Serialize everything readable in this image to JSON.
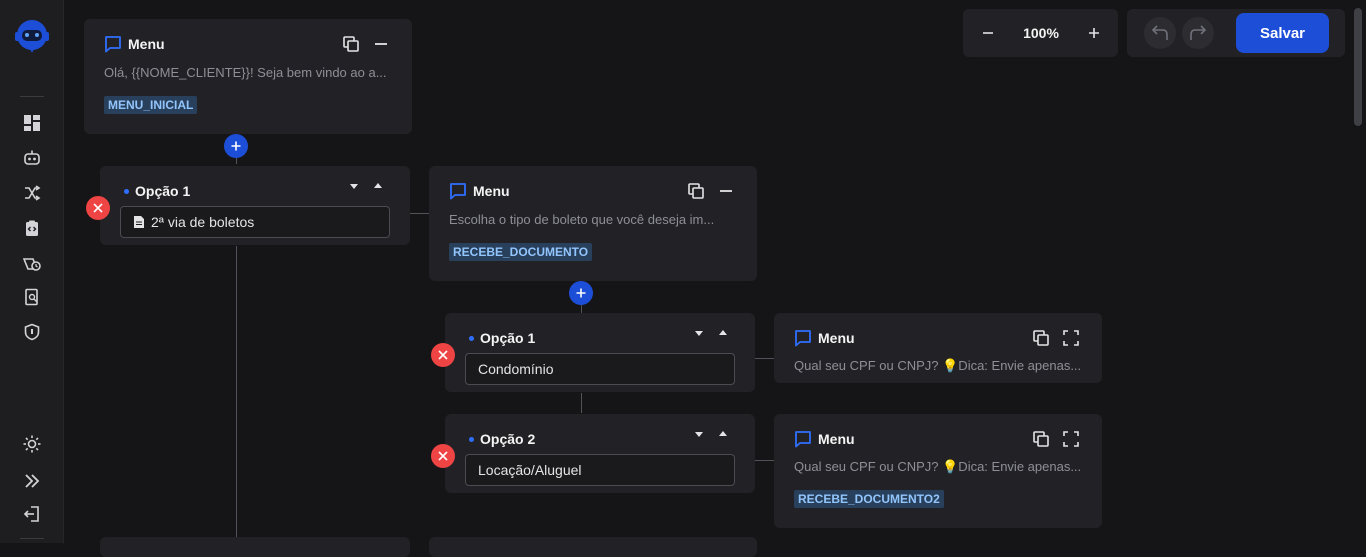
{
  "colors": {
    "accent": "#1d4ed8",
    "danger": "#ef4444",
    "tag_text": "#93c5fd",
    "tag_bg": "#28405c"
  },
  "sidebar": {
    "logo_icon": "robot-logo-icon",
    "items": [
      {
        "icon": "dashboard-icon"
      },
      {
        "icon": "robot-icon"
      },
      {
        "icon": "shuffle-icon"
      },
      {
        "icon": "code-clipboard-icon"
      },
      {
        "icon": "broadcast-clock-icon"
      },
      {
        "icon": "document-search-icon"
      },
      {
        "icon": "shield-icon"
      }
    ],
    "bottom_items": [
      {
        "icon": "sun-icon"
      },
      {
        "icon": "double-chevron-right-icon"
      },
      {
        "icon": "logout-icon"
      }
    ]
  },
  "toolbar": {
    "zoom": "100%",
    "save_label": "Salvar"
  },
  "flow": {
    "menu_root": {
      "title": "Menu",
      "text": "Olá, {{NOME_CLIENTE}}! Seja bem vindo ao a...",
      "tag": "MENU_INICIAL"
    },
    "option_a1": {
      "label": "Opção 1",
      "value": "2ª via de boletos"
    },
    "menu_boleto": {
      "title": "Menu",
      "text": "Escolha o tipo de boleto que você deseja im...",
      "tag": "RECEBE_DOCUMENTO"
    },
    "option_b1": {
      "label": "Opção 1",
      "value": "Condomínio"
    },
    "menu_cond": {
      "title": "Menu",
      "text": "Qual seu CPF ou CNPJ? 💡Dica: Envie apenas..."
    },
    "option_b2": {
      "label": "Opção 2",
      "value": "Locação/Aluguel"
    },
    "menu_loc": {
      "title": "Menu",
      "text": "Qual seu CPF ou CNPJ? 💡Dica: Envie apenas...",
      "tag": "RECEBE_DOCUMENTO2"
    }
  }
}
